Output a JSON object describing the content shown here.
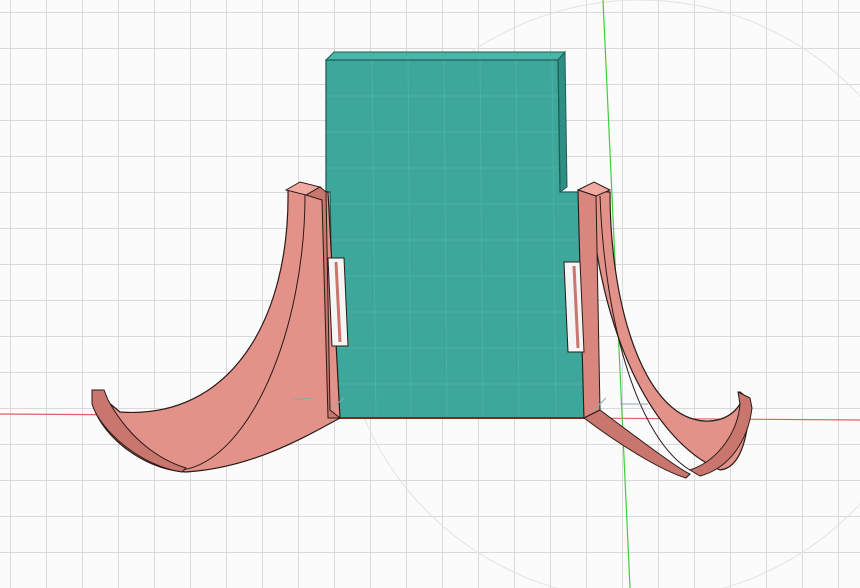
{
  "viewport": {
    "label": "",
    "colors": {
      "background": "#fbfbfb",
      "grid_line": "#d9d9d9",
      "x_axis": "#e06060",
      "y_axis": "#3ccf3c",
      "plate_fill": "#3ea79b",
      "plate_top": "#48b7aa",
      "plate_side": "#2f8f85",
      "plate_edge": "#1f5e57",
      "bracket_fill": "#e3928a",
      "bracket_dark": "#c9766e",
      "bracket_edge": "#2a1a18",
      "slot_fill": "#f5f5f5"
    }
  },
  "model": {
    "bodies": [
      {
        "name": "plate",
        "icon": "plate-body-icon"
      },
      {
        "name": "left-bracket",
        "icon": "bracket-body-icon"
      },
      {
        "name": "right-bracket",
        "icon": "bracket-body-icon"
      }
    ]
  }
}
